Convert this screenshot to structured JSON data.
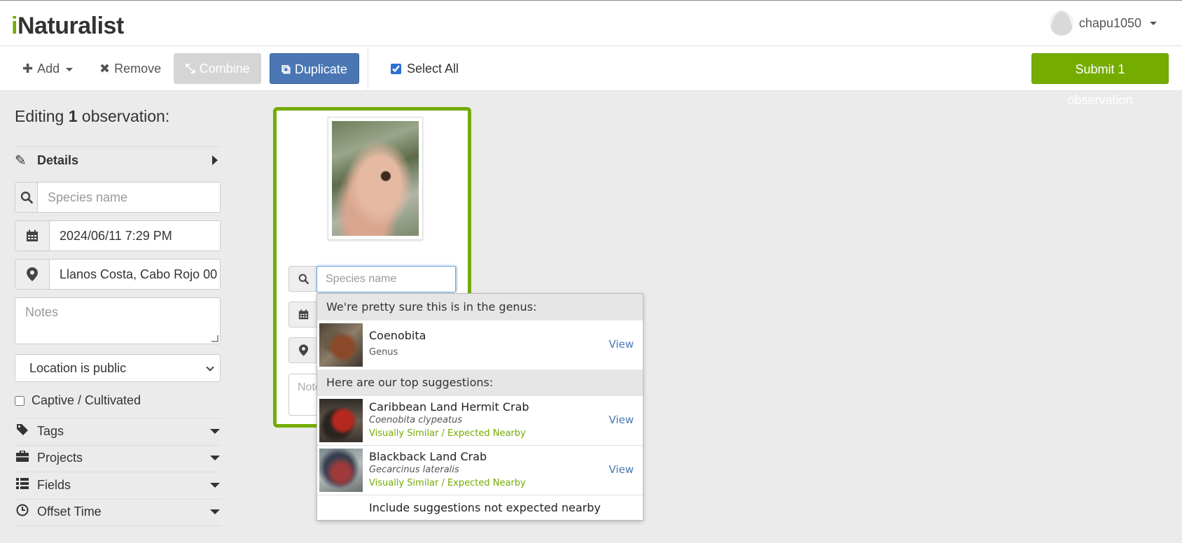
{
  "header": {
    "logo_i": "i",
    "logo_rest": "Naturalist",
    "username": "chapu1050"
  },
  "toolbar": {
    "add_label": "Add",
    "remove_label": "Remove",
    "combine_label": "Combine",
    "duplicate_label": "Duplicate",
    "select_all_label": "Select All",
    "select_all_checked": true,
    "submit_label": "Submit 1 observation"
  },
  "left_panel": {
    "editing_prefix": "Editing ",
    "editing_count": "1",
    "editing_suffix": " observation:",
    "details_label": "Details",
    "species_placeholder": "Species name",
    "date_value": "2024/06/11 7:29 PM",
    "location_value": "Llanos Costa, Cabo Rojo 00",
    "notes_placeholder": "Notes",
    "location_privacy": "Location is public",
    "captive_label": "Captive / Cultivated",
    "sections": [
      {
        "label": "Tags",
        "icon": "tag-icon"
      },
      {
        "label": "Projects",
        "icon": "briefcase-icon"
      },
      {
        "label": "Fields",
        "icon": "list-icon"
      },
      {
        "label": "Offset Time",
        "icon": "clock-icon"
      }
    ]
  },
  "card": {
    "species_placeholder": "Species name",
    "notes_placeholder": "Notes"
  },
  "suggestions": {
    "genus_header": "We're pretty sure this is in the genus:",
    "genus": {
      "name": "Coenobita",
      "rank": "Genus",
      "view": "View"
    },
    "top_header": "Here are our top suggestions:",
    "items": [
      {
        "common": "Caribbean Land Hermit Crab",
        "scientific": "Coenobita clypeatus",
        "reason": "Visually Similar / Expected Nearby",
        "view": "View"
      },
      {
        "common": "Blackback Land Crab",
        "scientific": "Gecarcinus lateralis",
        "reason": "Visually Similar / Expected Nearby",
        "view": "View"
      }
    ],
    "footer": "Include suggestions not expected nearby"
  },
  "colors": {
    "brand_green": "#74ac00",
    "primary_blue": "#4a76b4"
  }
}
